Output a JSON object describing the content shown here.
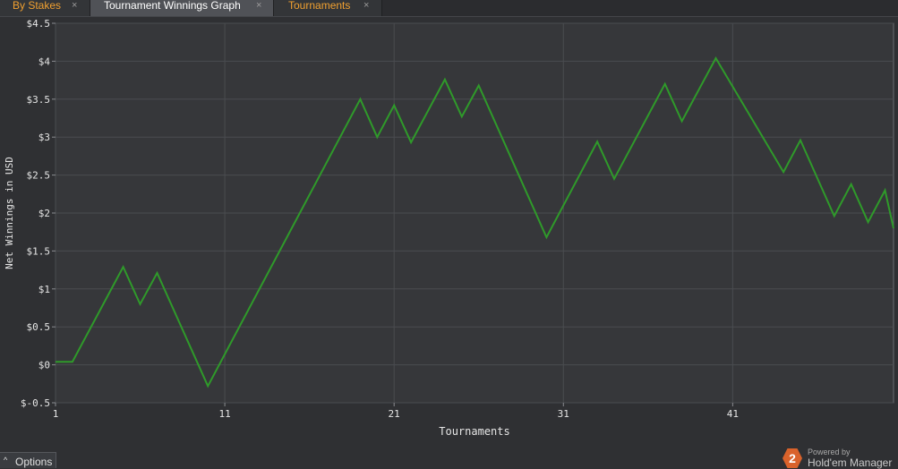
{
  "tabs": [
    {
      "label": "By Stakes",
      "close": "×"
    },
    {
      "label": "Tournament Winnings Graph",
      "close": "×"
    },
    {
      "label": "Tournaments",
      "close": "×"
    }
  ],
  "colors": {
    "line": "#2f9a2a",
    "background": "#2f3033",
    "grid": "#4a4c50",
    "axis_text": "#e6e6e6",
    "tab_highlight": "#f0a030"
  },
  "chart_data": {
    "type": "line",
    "title": "",
    "xlabel": "Tournaments",
    "ylabel": "Net Winnings in USD",
    "xlim": [
      1,
      50.5
    ],
    "ylim": [
      -0.5,
      4.5
    ],
    "x_ticks": [
      1,
      11,
      21,
      31,
      41
    ],
    "y_ticks": [
      -0.5,
      0,
      0.5,
      1,
      1.5,
      2,
      2.5,
      3,
      3.5,
      4,
      4.5
    ],
    "y_tick_labels": [
      "$-0.5",
      "$0",
      "$0.5",
      "$1",
      "$1.5",
      "$2",
      "$2.5",
      "$3",
      "$3.5",
      "$4",
      "$4.5"
    ],
    "grid": true,
    "legend": "none",
    "series": [
      {
        "x": [
          1,
          2,
          5,
          6,
          7,
          10,
          19,
          20,
          21,
          22,
          24,
          25,
          26,
          30,
          33,
          34,
          37,
          38,
          40,
          44,
          45,
          47,
          48,
          49,
          50,
          50.5
        ],
        "y": [
          0.04,
          0.04,
          1.29,
          0.8,
          1.21,
          -0.28,
          3.5,
          3.0,
          3.42,
          2.93,
          3.76,
          3.27,
          3.68,
          1.68,
          2.94,
          2.45,
          3.7,
          3.21,
          4.04,
          2.54,
          2.96,
          1.96,
          2.38,
          1.88,
          2.3,
          1.8
        ]
      }
    ]
  },
  "footer": {
    "options_label": "Options",
    "options_arrow": "^"
  },
  "brand": {
    "badge": "2",
    "powered": "Powered by",
    "name": "Hold'em Manager"
  }
}
